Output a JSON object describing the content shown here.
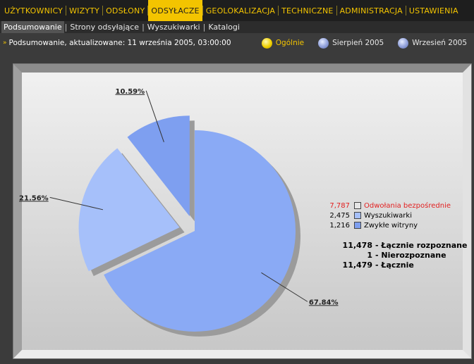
{
  "nav": {
    "items": [
      {
        "label": "UŻYTKOWNICY"
      },
      {
        "label": "WIZYTY"
      },
      {
        "label": "ODSŁONY"
      },
      {
        "label": "ODSYŁACZE"
      },
      {
        "label": "GEOLOKALIZACJA"
      },
      {
        "label": "TECHNICZNE"
      },
      {
        "label": "ADMINISTRACJA"
      },
      {
        "label": "USTAWIENIA"
      }
    ],
    "active_index": 3
  },
  "subnav": {
    "items": [
      {
        "label": "Podsumowanie"
      },
      {
        "label": "Strony odsyłające"
      },
      {
        "label": "Wyszukiwarki"
      },
      {
        "label": "Katalogi"
      }
    ],
    "active_index": 0
  },
  "status": {
    "text": "Podsumowanie, aktualizowane: 11 września 2005, 03:00:00"
  },
  "periods": [
    {
      "label": "Ogólnie",
      "selected": true
    },
    {
      "label": "Sierpień 2005",
      "selected": false
    },
    {
      "label": "Wrzesień 2005",
      "selected": false
    }
  ],
  "chart_data": {
    "type": "pie",
    "slices": [
      {
        "label": "67.84%",
        "value": 67.84,
        "color": "#8aaaf5"
      },
      {
        "label": "21.56%",
        "value": 21.56,
        "color": "#a6c0fa"
      },
      {
        "label": "10.59%",
        "value": 10.59,
        "color": "#7e9ff0"
      }
    ],
    "legend": [
      {
        "count": "7,787",
        "label": "Odwołania bezpośrednie",
        "color": "#e6e6e6"
      },
      {
        "count": "2,475",
        "label": "Wyszukiwarki",
        "color": "#a6c0fa"
      },
      {
        "count": "1,216",
        "label": "Zwykłe witryny",
        "color": "#7e9ff0"
      }
    ]
  },
  "totals": [
    {
      "count": "11,478",
      "label": "- Łącznie rozpoznane"
    },
    {
      "count": "1",
      "label": "- Nierozpoznane"
    },
    {
      "count": "11,479",
      "label": "- Łącznie"
    }
  ],
  "colors": {
    "accent": "#f3c400",
    "nav_bg": "#1e1e1e",
    "page_bg": "#3b3b3b",
    "highlight_text": "#e22121"
  }
}
